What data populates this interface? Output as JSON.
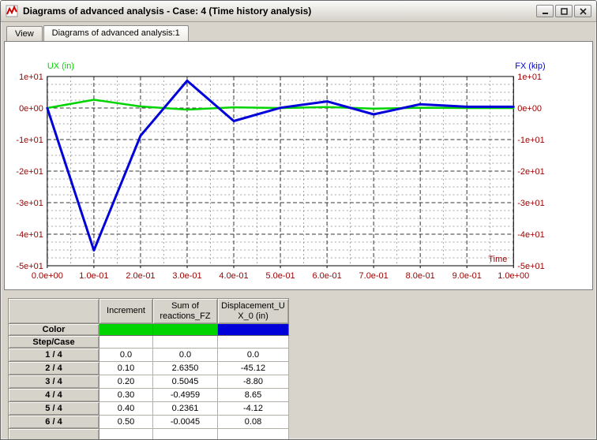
{
  "window": {
    "title": "Diagrams of advanced analysis - Case: 4 (Time history analysis)",
    "controls": {
      "minimize": "minimize",
      "maximize": "maximize",
      "close": "close"
    }
  },
  "tabs": [
    {
      "label": "View",
      "active": false
    },
    {
      "label": "Diagrams of advanced analysis:1",
      "active": true
    }
  ],
  "chart_data": {
    "type": "line",
    "title": "",
    "xlabel": "Time",
    "left_axis_label": "UX (in)",
    "right_axis_label": "FX (kip)",
    "left_axis_color": "#00d400",
    "right_axis_color": "#0000d8",
    "tick_label_color": "#990000",
    "grid": true,
    "legend_position": "none",
    "xlim": [
      0.0,
      1.0
    ],
    "ylim": [
      -50,
      10
    ],
    "x_ticks": [
      "0.0e+00",
      "1.0e-01",
      "2.0e-01",
      "3.0e-01",
      "4.0e-01",
      "5.0e-01",
      "6.0e-01",
      "7.0e-01",
      "8.0e-01",
      "9.0e-01",
      "1.0e+00"
    ],
    "x_tick_values": [
      0.0,
      0.1,
      0.2,
      0.3,
      0.4,
      0.5,
      0.6,
      0.7,
      0.8,
      0.9,
      1.0
    ],
    "y_ticks": [
      "1e+01",
      "0e+00",
      "-1e+01",
      "-2e+01",
      "-3e+01",
      "-4e+01",
      "-5e+01"
    ],
    "y_tick_values": [
      10,
      0,
      -10,
      -20,
      -30,
      -40,
      -50
    ],
    "series": [
      {
        "name": "Sum of reactions_FZ",
        "color": "#00d400",
        "width": 2.5,
        "x": [
          0.0,
          0.1,
          0.2,
          0.3,
          0.4,
          0.5,
          0.6,
          0.7,
          0.8,
          0.9,
          1.0
        ],
        "values": [
          0.0,
          2.635,
          0.5045,
          -0.4959,
          0.2361,
          -0.0045,
          0.3,
          -0.2,
          0.1,
          0.0,
          0.0
        ]
      },
      {
        "name": "Displacement_UX_0 (in)",
        "color": "#0000d8",
        "width": 3,
        "x": [
          0.0,
          0.1,
          0.2,
          0.3,
          0.4,
          0.5,
          0.6,
          0.7,
          0.8,
          0.9,
          1.0
        ],
        "values": [
          0.0,
          -45.12,
          -8.8,
          8.65,
          -4.12,
          0.08,
          2.1,
          -2.0,
          1.2,
          0.4,
          0.4
        ]
      }
    ]
  },
  "table": {
    "columns": [
      "",
      "Increment",
      "Sum of\nreactions_FZ",
      "Displacement_U\nX_0 (in)"
    ],
    "color_row": {
      "label": "Color",
      "colors": [
        "#00d400",
        "#00d400",
        "#0000d8"
      ]
    },
    "step_row_label": "Step/Case",
    "rows": [
      {
        "label": "1 / 4",
        "values": [
          "0.0",
          "0.0",
          "0.0"
        ]
      },
      {
        "label": "2 / 4",
        "values": [
          "0.10",
          "2.6350",
          "-45.12"
        ]
      },
      {
        "label": "3 / 4",
        "values": [
          "0.20",
          "0.5045",
          "-8.80"
        ]
      },
      {
        "label": "4 / 4",
        "values": [
          "0.30",
          "-0.4959",
          "8.65"
        ]
      },
      {
        "label": "5 / 4",
        "values": [
          "0.40",
          "0.2361",
          "-4.12"
        ]
      },
      {
        "label": "6 / 4",
        "values": [
          "0.50",
          "-0.0045",
          "0.08"
        ]
      },
      {
        "label": "",
        "values": [
          "",
          "",
          ""
        ]
      }
    ]
  }
}
